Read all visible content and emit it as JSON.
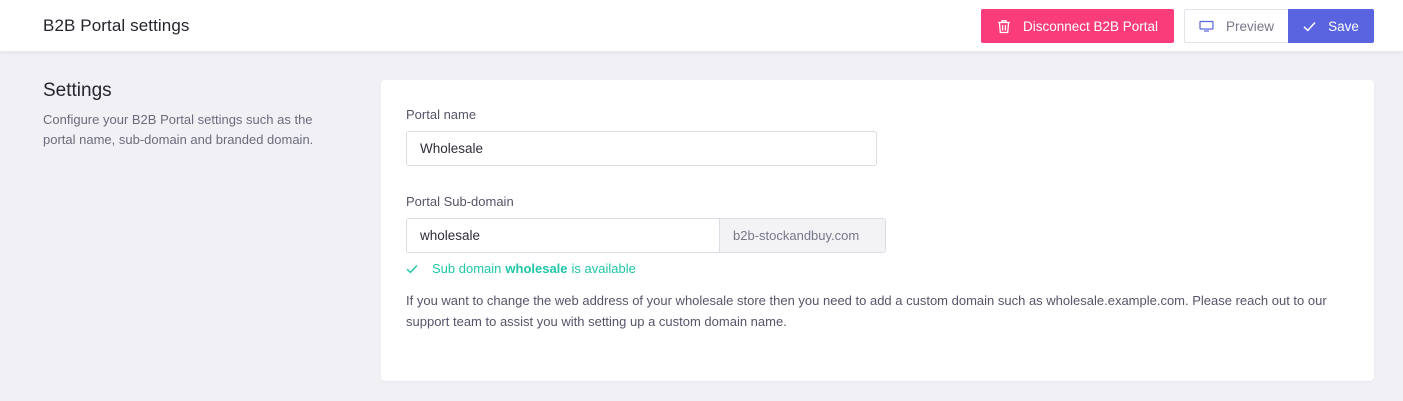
{
  "header": {
    "title": "B2B Portal settings",
    "disconnect_label": "Disconnect B2B Portal",
    "preview_label": "Preview",
    "save_label": "Save"
  },
  "section": {
    "title": "Settings",
    "description": "Configure your B2B Portal settings such as the portal name, sub-domain and branded domain."
  },
  "form": {
    "portal_name_label": "Portal name",
    "portal_name_value": "Wholesale",
    "subdomain_label": "Portal Sub-domain",
    "subdomain_value": "wholesale",
    "subdomain_suffix": "b2b-stockandbuy.com",
    "availability_prefix": "Sub domain",
    "availability_name": "wholesale",
    "availability_suffix": "is available",
    "help_text": "If you want to change the web address of your wholesale store then you need to add a custom domain such as wholesale.example.com. Please reach out to our support team to assist you with setting up a custom domain name."
  },
  "colors": {
    "danger": "#fb3c7a",
    "primary": "#5a63e0",
    "success": "#1fc6a8"
  },
  "icons": {
    "disconnect": "trash-icon",
    "preview": "monitor-icon",
    "save": "check-icon",
    "availability": "check-icon"
  }
}
